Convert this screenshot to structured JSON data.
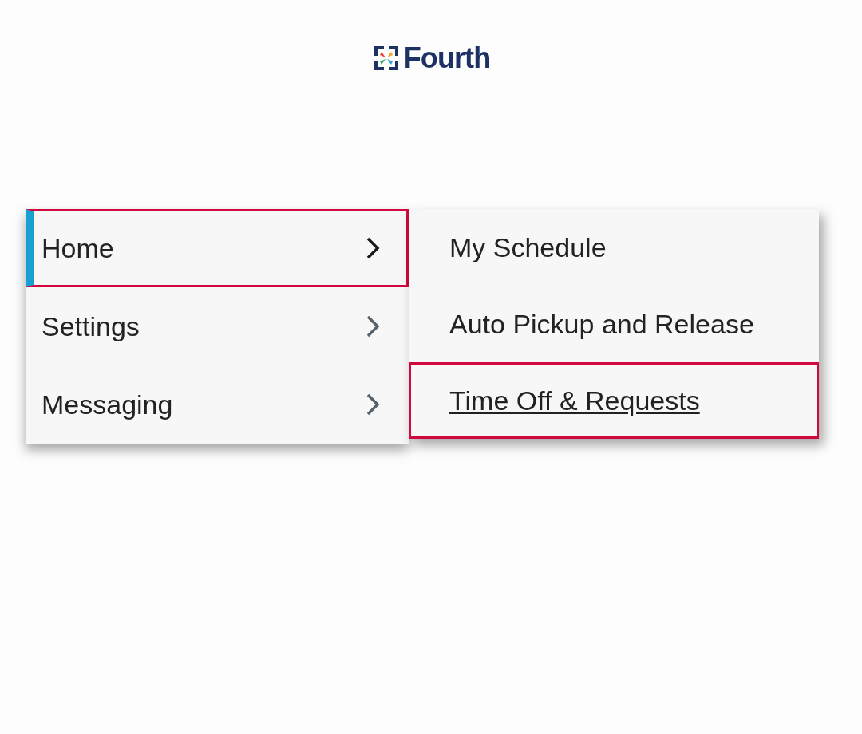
{
  "logo": {
    "text": "Fourth"
  },
  "menu": {
    "items": [
      {
        "label": "Home",
        "selected": true,
        "highlighted": true
      },
      {
        "label": "Settings",
        "selected": false,
        "highlighted": false
      },
      {
        "label": "Messaging",
        "selected": false,
        "highlighted": false
      }
    ]
  },
  "submenu": {
    "items": [
      {
        "label": "My Schedule",
        "hovered": false,
        "highlighted": false
      },
      {
        "label": "Auto Pickup and Release",
        "hovered": false,
        "highlighted": false
      },
      {
        "label": "Time Off & Requests",
        "hovered": true,
        "highlighted": true
      }
    ]
  }
}
